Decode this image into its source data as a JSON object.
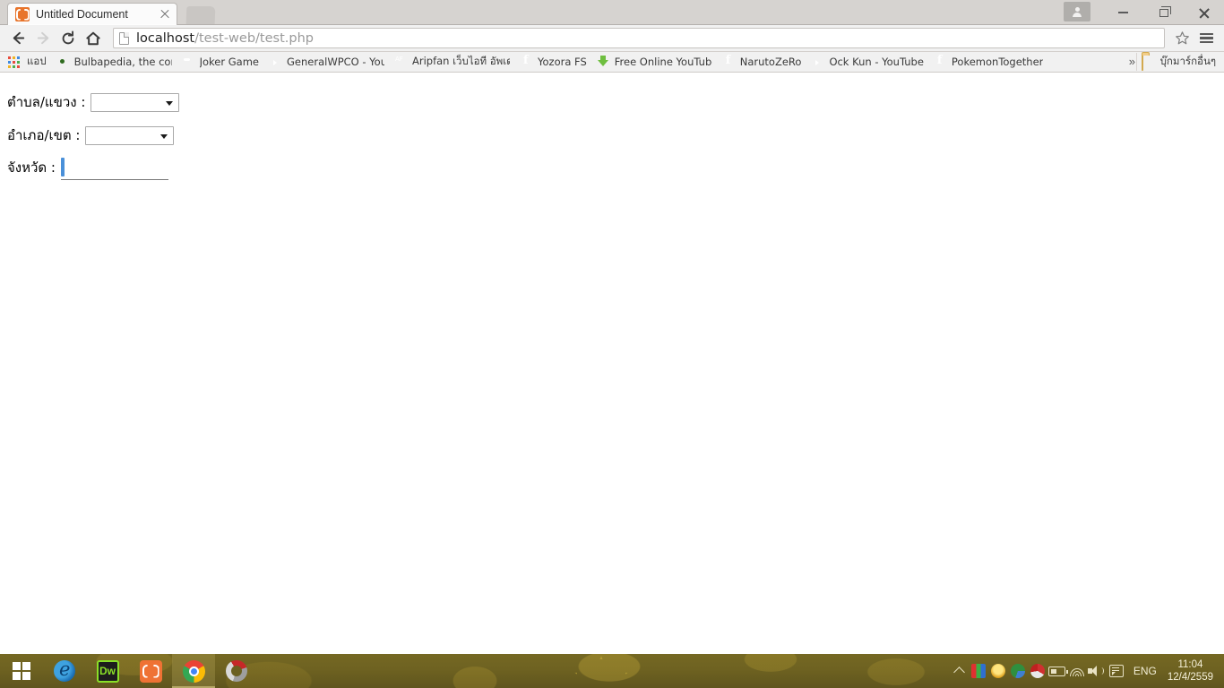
{
  "browser": {
    "tab": {
      "title": "Untitled Document",
      "favicon": "xampp-icon",
      "close_icon": "close-icon"
    },
    "new_tab_icon": "new-tab-icon",
    "window_controls": {
      "avatar_icon": "avatar-icon",
      "minimize_icon": "minimize-icon",
      "maximize_icon": "maximize-icon",
      "close_icon": "close-icon"
    },
    "toolbar": {
      "back_icon": "back-arrow-icon",
      "forward_icon": "forward-arrow-icon",
      "reload_icon": "reload-icon",
      "home_icon": "home-icon",
      "page_icon": "page-document-icon",
      "url_host": "localhost",
      "url_path": "/test-web/test.php",
      "star_icon": "star-icon",
      "menu_icon": "hamburger-menu-icon"
    },
    "bookmarks": {
      "items": [
        {
          "label": "แอป",
          "icon": "apps-grid-icon"
        },
        {
          "label": "Bulbapedia, the comm",
          "icon": "bulbapedia-icon"
        },
        {
          "label": "Joker Game",
          "icon": "joker-game-icon"
        },
        {
          "label": "GeneralWPCO - YouT",
          "icon": "youtube-icon"
        },
        {
          "label": "Aripfan เว็บไอที อัพเดท",
          "icon": "aripfan-icon"
        },
        {
          "label": "Yozora FS",
          "icon": "facebook-icon"
        },
        {
          "label": "Free Online YouTube",
          "icon": "download-icon"
        },
        {
          "label": "NarutoZeRo",
          "icon": "facebook-icon"
        },
        {
          "label": "Ock Kun - YouTube",
          "icon": "youtube-icon"
        },
        {
          "label": "PokemonTogether",
          "icon": "facebook-icon"
        }
      ],
      "overflow_label": "»",
      "other_bookmarks": {
        "label": "บุ๊กมาร์กอื่นๆ",
        "icon": "folder-icon"
      }
    }
  },
  "page": {
    "form": {
      "rows": [
        {
          "label": "ตำบล/แขวง :",
          "value": "",
          "name": "subdistrict"
        },
        {
          "label": "อำเภอ/เขต :",
          "value": "",
          "name": "district"
        },
        {
          "label": "จังหวัด :",
          "value": "",
          "name": "province"
        }
      ],
      "open_dropdown": {
        "field": "province",
        "options": [
          ""
        ],
        "highlight_color": "#1e90e8"
      }
    }
  },
  "taskbar": {
    "start_label": "Start",
    "items": [
      {
        "name": "start-button",
        "icon": "windows-logo-icon"
      },
      {
        "name": "taskbar-item-edge",
        "icon": "edge-icon"
      },
      {
        "name": "taskbar-item-dreamweaver",
        "icon": "dreamweaver-icon"
      },
      {
        "name": "taskbar-item-xampp",
        "icon": "xampp-icon"
      },
      {
        "name": "taskbar-item-chrome",
        "icon": "chrome-icon"
      },
      {
        "name": "taskbar-item-app",
        "icon": "app-icon"
      }
    ],
    "tray": {
      "chevron_icon": "chevron-up-icon",
      "icons": [
        "tray-app-icon-1",
        "tray-app-icon-2",
        "tray-app-icon-3",
        "tray-app-icon-4",
        "battery-icon",
        "wifi-icon",
        "volume-icon",
        "notifications-icon"
      ],
      "language": "ENG",
      "time": "11:04",
      "date": "12/4/2559"
    }
  }
}
